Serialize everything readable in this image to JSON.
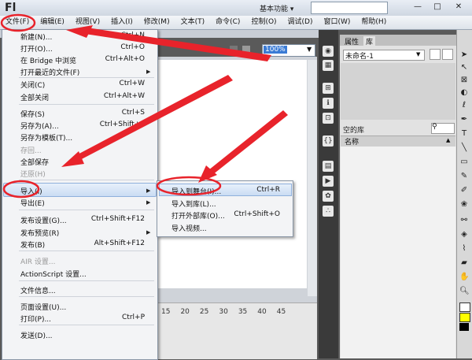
{
  "app": {
    "logo": "Fl",
    "workspace": "基本功能 ▾",
    "window_buttons": [
      "—",
      "□",
      "✕"
    ]
  },
  "menubar": [
    {
      "label": "文件(F)"
    },
    {
      "label": "编辑(E)"
    },
    {
      "label": "视图(V)"
    },
    {
      "label": "插入(I)"
    },
    {
      "label": "修改(M)"
    },
    {
      "label": "文本(T)"
    },
    {
      "label": "命令(C)"
    },
    {
      "label": "控制(O)"
    },
    {
      "label": "调试(D)"
    },
    {
      "label": "窗口(W)"
    },
    {
      "label": "帮助(H)"
    }
  ],
  "zoom": "100%",
  "timeline_numbers": [
    "15",
    "20",
    "25",
    "30",
    "35",
    "40",
    "45"
  ],
  "file_menu": [
    {
      "label": "新建(N)...",
      "shortcut": "Ctrl+N"
    },
    {
      "label": "打开(O)...",
      "shortcut": "Ctrl+O"
    },
    {
      "label": "在 Bridge 中浏览",
      "shortcut": "Ctrl+Alt+O"
    },
    {
      "label": "打开最近的文件(F)",
      "shortcut": "",
      "submenu": true
    },
    {
      "label": "关闭(C)",
      "shortcut": "Ctrl+W"
    },
    {
      "label": "全部关闭",
      "shortcut": "Ctrl+Alt+W"
    },
    {
      "label": "保存(S)",
      "shortcut": "Ctrl+S"
    },
    {
      "label": "另存为(A)...",
      "shortcut": "Ctrl+Shift+S"
    },
    {
      "label": "另存为模板(T)...",
      "shortcut": ""
    },
    {
      "label": "存回...",
      "shortcut": "",
      "disabled": true
    },
    {
      "label": "全部保存",
      "shortcut": ""
    },
    {
      "label": "还原(H)",
      "shortcut": "",
      "disabled": true
    },
    {
      "label": "导入(I)",
      "shortcut": "",
      "submenu": true
    },
    {
      "label": "导出(E)",
      "shortcut": "",
      "submenu": true
    },
    {
      "label": "发布设置(G)...",
      "shortcut": "Ctrl+Shift+F12"
    },
    {
      "label": "发布预览(R)",
      "shortcut": "",
      "submenu": true
    },
    {
      "label": "发布(B)",
      "shortcut": "Alt+Shift+F12"
    },
    {
      "label": "AIR 设置...",
      "shortcut": "",
      "disabled": true
    },
    {
      "label": "ActionScript 设置...",
      "shortcut": ""
    },
    {
      "label": "文件信息...",
      "shortcut": ""
    },
    {
      "label": "页面设置(U)...",
      "shortcut": ""
    },
    {
      "label": "打印(P)...",
      "shortcut": "Ctrl+P"
    },
    {
      "label": "发送(D)...",
      "shortcut": ""
    }
  ],
  "import_submenu": [
    {
      "label": "导入到舞台(I)...",
      "shortcut": "Ctrl+R"
    },
    {
      "label": "导入到库(L)...",
      "shortcut": ""
    },
    {
      "label": "打开外部库(O)...",
      "shortcut": "Ctrl+Shift+O"
    },
    {
      "label": "导入视频...",
      "shortcut": ""
    }
  ],
  "library": {
    "tabs": [
      "属性",
      "库"
    ],
    "document": "未命名-1",
    "count": "空的库",
    "column_name": "名称"
  },
  "colors": {
    "highlight": "#cadcf3",
    "annotation": "#e8232b",
    "stroke_swatch": "#000000",
    "fill_swatch": "#ffff00"
  }
}
